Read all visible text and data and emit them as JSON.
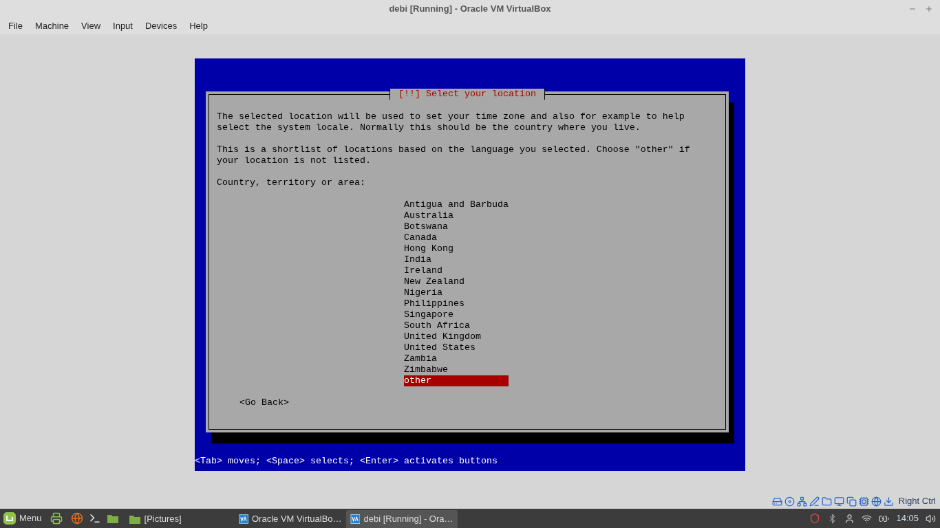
{
  "window": {
    "title": "debi [Running] - Oracle VM VirtualBox"
  },
  "menu": [
    "File",
    "Machine",
    "View",
    "Input",
    "Devices",
    "Help"
  ],
  "installer": {
    "title": "[!!] Select your location",
    "paragraphs": [
      "The selected location will be used to set your time zone and also for example to help\nselect the system locale. Normally this should be the country where you live.",
      "This is a shortlist of locations based on the language you selected. Choose \"other\" if\nyour location is not listed."
    ],
    "prompt": "Country, territory or area:",
    "options": [
      {
        "label": "Antigua and Barbuda",
        "selected": false
      },
      {
        "label": "Australia",
        "selected": false
      },
      {
        "label": "Botswana",
        "selected": false
      },
      {
        "label": "Canada",
        "selected": false
      },
      {
        "label": "Hong Kong",
        "selected": false
      },
      {
        "label": "India",
        "selected": false
      },
      {
        "label": "Ireland",
        "selected": false
      },
      {
        "label": "New Zealand",
        "selected": false
      },
      {
        "label": "Nigeria",
        "selected": false
      },
      {
        "label": "Philippines",
        "selected": false
      },
      {
        "label": "Singapore",
        "selected": false
      },
      {
        "label": "South Africa",
        "selected": false
      },
      {
        "label": "United Kingdom",
        "selected": false
      },
      {
        "label": "United States",
        "selected": false
      },
      {
        "label": "Zambia",
        "selected": false
      },
      {
        "label": "Zimbabwe",
        "selected": false
      },
      {
        "label": "other",
        "selected": true
      }
    ],
    "back_button": "<Go Back>",
    "help_line": "<Tab> moves; <Space> selects; <Enter> activates buttons"
  },
  "status_bar": {
    "host_key": "Right Ctrl"
  },
  "taskbar": {
    "menu": "Menu",
    "windows": [
      {
        "label": "[Pictures]",
        "kind": "folder",
        "selected": false
      },
      {
        "label": "Oracle VM VirtualBo…",
        "kind": "vbox",
        "selected": false
      },
      {
        "label": "debi [Running] - Ora…",
        "kind": "vbox",
        "selected": true
      }
    ],
    "clock": "14:05"
  }
}
